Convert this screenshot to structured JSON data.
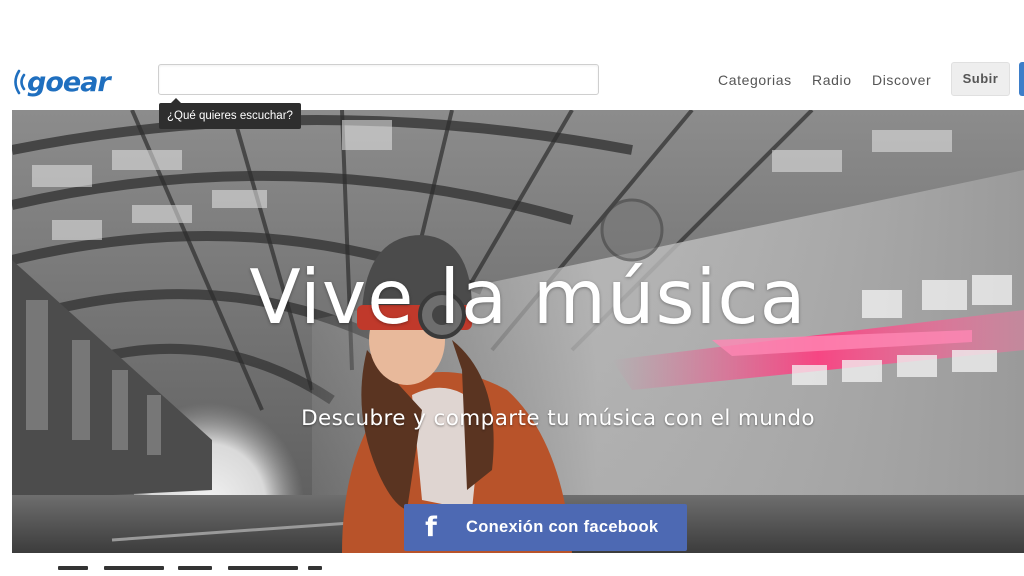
{
  "header": {
    "logo_text": "goear",
    "search": {
      "value": "",
      "tooltip": "¿Qué quieres escuchar?"
    },
    "nav": [
      {
        "label": "Categorias"
      },
      {
        "label": "Radio"
      },
      {
        "label": "Discover"
      }
    ],
    "upload_label": "Subir"
  },
  "hero": {
    "title": "Vive la música",
    "subtitle": "Descubre y comparte tu música con el mundo",
    "facebook_button": {
      "icon": "f",
      "label": "Conexión con facebook"
    }
  },
  "colors": {
    "brand": "#1f6fbf",
    "facebook": "#4d69b3",
    "tooltip_bg": "#2e2e2e"
  },
  "icons": {
    "logo": "sound-waves-icon",
    "facebook": "facebook-icon"
  }
}
